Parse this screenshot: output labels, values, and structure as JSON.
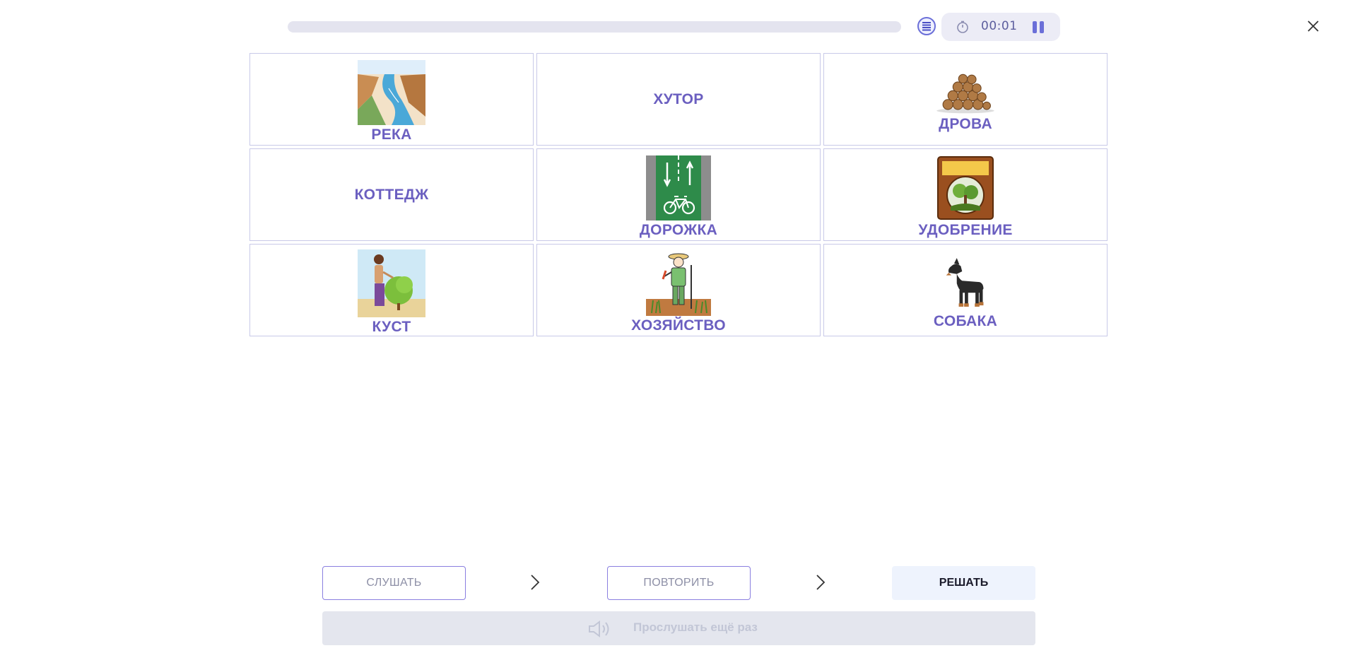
{
  "header": {
    "timer": "00:01",
    "progress_fraction": 0.0
  },
  "cards": [
    {
      "label": "РЕКА",
      "icon": "river-picture"
    },
    {
      "label": "ХУТОР",
      "icon": null
    },
    {
      "label": "ДРОВА",
      "icon": "firewood-picture"
    },
    {
      "label": "КОТТЕДЖ",
      "icon": null
    },
    {
      "label": "ДОРОЖКА",
      "icon": "bike-lane-picture"
    },
    {
      "label": "УДОБРЕНИЕ",
      "icon": "fertilizer-bag-picture"
    },
    {
      "label": "КУСТ",
      "icon": "gardener-bush-picture"
    },
    {
      "label": "ХОЗЯЙСТВО",
      "icon": "farmer-picture"
    },
    {
      "label": "СОБАКА",
      "icon": "dog-picture"
    }
  ],
  "footer": {
    "listen_label": "СЛУШАТЬ",
    "repeat_label": "ПОВТОРИТЬ",
    "solve_label": "РЕШАТЬ",
    "replay_label": "Прослушать ещё раз"
  },
  "colors": {
    "accent": "#6b6fd8",
    "label": "#6b5fc0",
    "card_border": "#c8c9e8"
  }
}
